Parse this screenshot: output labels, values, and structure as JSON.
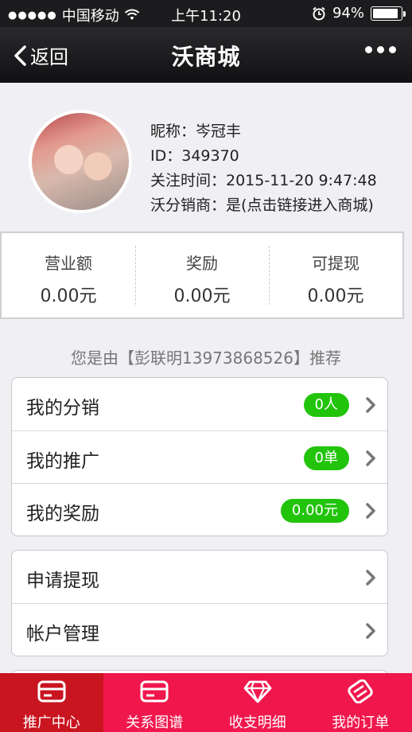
{
  "status_bar": {
    "signal_dots": "●●●●●",
    "carrier": "中国移动",
    "time": "上午11:20",
    "battery": "94%",
    "battery_level": 0.94
  },
  "nav": {
    "back_label": "返回",
    "title": "沃商城"
  },
  "profile": {
    "nickname": "昵称：岑冠丰",
    "id": "ID：349370",
    "follow_time": "关注时间：2015-11-20 9:47:48",
    "distributor": "沃分销商：是(点击链接进入商城)"
  },
  "stats": [
    {
      "label": "营业额",
      "value": "0.00元"
    },
    {
      "label": "奖励",
      "value": "0.00元"
    },
    {
      "label": "可提现",
      "value": "0.00元"
    }
  ],
  "referrer": "您是由【彭联明13973868526】推荐",
  "menu_group_1": [
    {
      "label": "我的分销",
      "badge": "0人"
    },
    {
      "label": "我的推广",
      "badge": "0单"
    },
    {
      "label": "我的奖励",
      "badge": "0.00元"
    }
  ],
  "menu_group_2": [
    {
      "label": "申请提现"
    },
    {
      "label": "帐户管理"
    }
  ],
  "tabs": [
    {
      "label": "推广中心",
      "icon": "card-icon",
      "active": true
    },
    {
      "label": "关系图谱",
      "icon": "card-icon",
      "active": false
    },
    {
      "label": "收支明细",
      "icon": "diamond-icon",
      "active": false
    },
    {
      "label": "我的订单",
      "icon": "tag-icon",
      "active": false
    }
  ],
  "colors": {
    "tab_bar": "#f0174c",
    "tab_active": "#c91520",
    "badge": "#21c40b",
    "nav_bar": "#1c1c1e"
  }
}
